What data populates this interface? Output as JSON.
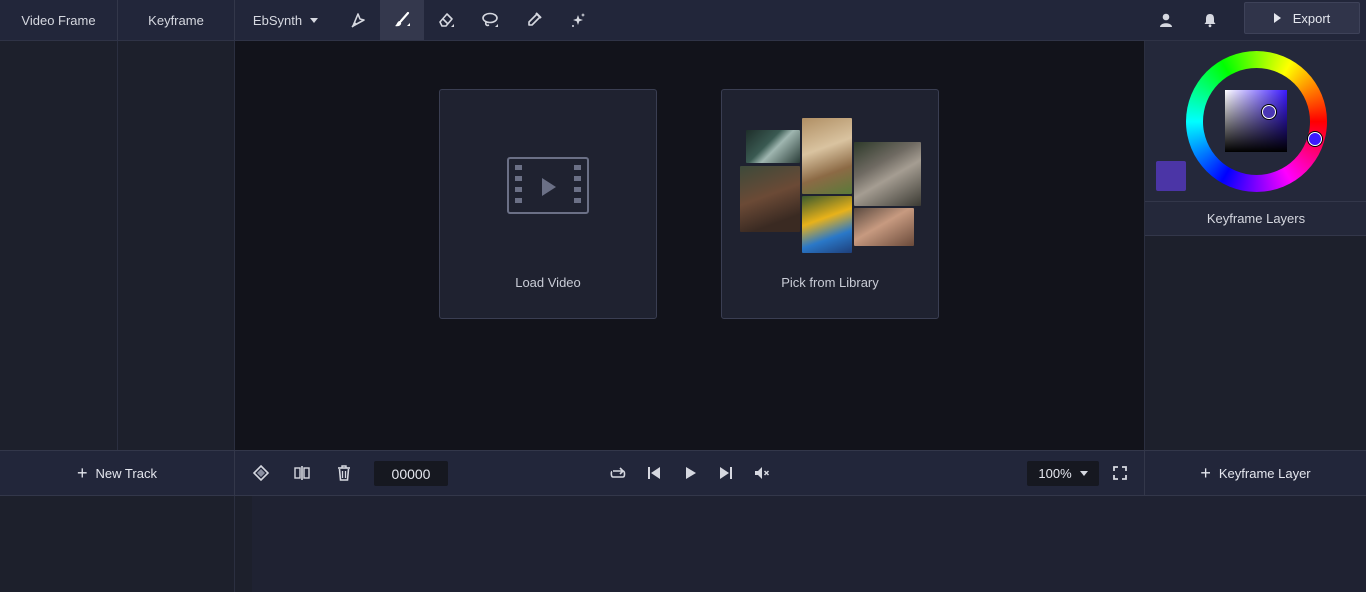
{
  "topbar": {
    "tabs": [
      {
        "label": "Video Frame"
      },
      {
        "label": "Keyframe"
      },
      {
        "label": "EbSynth"
      }
    ],
    "tools": [
      "pen-icon",
      "brush-icon",
      "eraser-icon",
      "lasso-icon",
      "eyedropper-icon",
      "sparkle-icon"
    ],
    "active_tool": "brush-icon",
    "export_label": "Export"
  },
  "canvas": {
    "load_video_label": "Load Video",
    "library_label": "Pick from Library"
  },
  "right_panel": {
    "current_color": "#4b35a6",
    "keyframe_layers_title": "Keyframe Layers"
  },
  "controls": {
    "new_track_label": "New Track",
    "timecode": "00000",
    "zoom": "100%",
    "keyframe_layer_label": "Keyframe Layer"
  }
}
